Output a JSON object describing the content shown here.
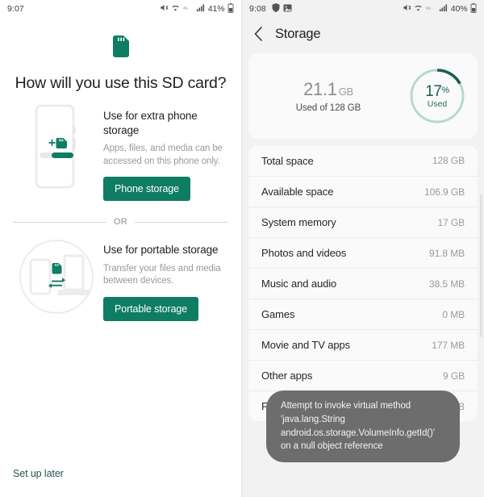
{
  "left_screen": {
    "statusbar": {
      "time": "9:07",
      "battery_text": "41%",
      "icons": [
        "mute-icon",
        "wifi-icon",
        "lte-icon",
        "signal-icon",
        "battery-icon"
      ]
    },
    "hero_icon": "sd-card-icon",
    "title": "How will you use this SD card?",
    "options": [
      {
        "art": "phone-with-sdcard-illustration",
        "title": "Use for extra phone storage",
        "description": "Apps, files, and media can be accessed on this phone only.",
        "button_label": "Phone storage"
      },
      {
        "art": "devices-transfer-illustration",
        "title": "Use for portable storage",
        "description": "Transfer your files and media between devices.",
        "button_label": "Portable storage"
      }
    ],
    "divider_text": "OR",
    "setup_later_label": "Set up later"
  },
  "right_screen": {
    "statusbar": {
      "time": "9:08",
      "battery_text": "40%",
      "left_icons": [
        "shield-icon",
        "image-icon"
      ],
      "right_icons": [
        "mute-icon",
        "wifi-icon",
        "lte-icon",
        "signal-icon",
        "battery-icon"
      ]
    },
    "appbar": {
      "back_icon": "chevron-left-icon",
      "title": "Storage"
    },
    "summary": {
      "used_amount": "21.1",
      "used_unit": "GB",
      "used_of_label": "Used of 128 GB",
      "percent_value": "17",
      "percent_symbol": "%",
      "percent_caption": "Used",
      "percent_number": 17,
      "donut_track_color": "#b8d8d2",
      "donut_arc_color": "#1d5b52"
    },
    "items": [
      {
        "label": "Total space",
        "value": "128 GB"
      },
      {
        "label": "Available space",
        "value": "106.9 GB"
      },
      {
        "label": "System memory",
        "value": "17 GB"
      },
      {
        "label": "Photos and videos",
        "value": "91.8 MB"
      },
      {
        "label": "Music and audio",
        "value": "38.5 MB"
      },
      {
        "label": "Games",
        "value": "0 MB"
      },
      {
        "label": "Movie and TV apps",
        "value": "177 MB"
      },
      {
        "label": "Other apps",
        "value": "9 GB"
      },
      {
        "label": "Files",
        "value": "792 KB"
      }
    ],
    "toast": {
      "message": "Attempt to invoke virtual method 'java.lang.String android.os.storage.VolumeInfo.getId()' on a null object reference"
    }
  },
  "colors": {
    "teal_accent": "#0f7d64",
    "dark_teal": "#1d5b52",
    "link_teal": "#20574f",
    "panel_bg": "#f2f2f2",
    "card_bg": "#fafafa"
  }
}
